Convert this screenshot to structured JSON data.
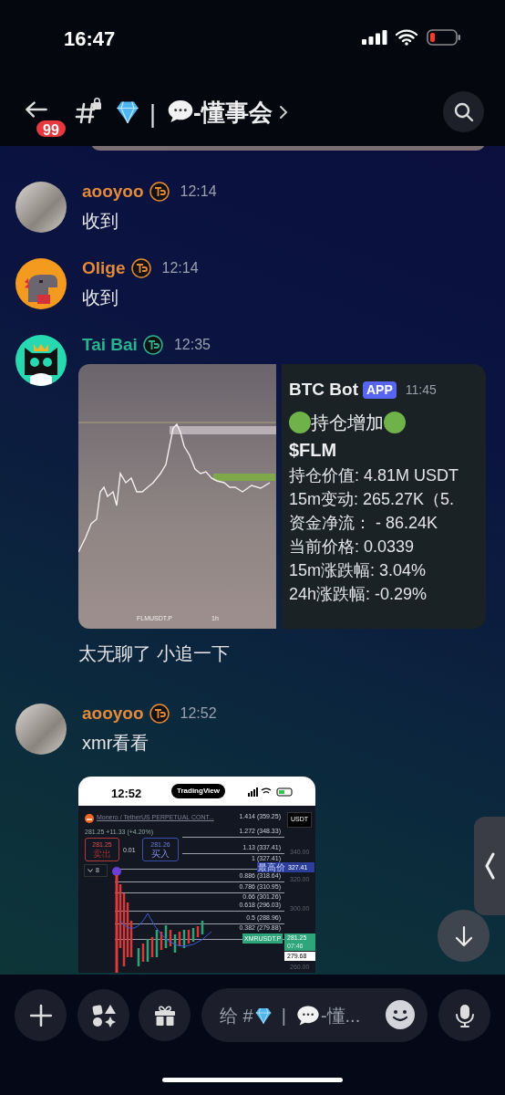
{
  "status_bar": {
    "time": "16:47"
  },
  "header": {
    "unread_badge": "99",
    "separator": "|",
    "channel_name": "-懂事会"
  },
  "messages": [
    {
      "author": "aooyoo",
      "color": "#e38a3b",
      "avatar": {
        "kind": "photo"
      },
      "time": "12:14",
      "text": "收到"
    },
    {
      "author": "Olige",
      "color": "#e38a3b",
      "avatar": {
        "kind": "dinosaur"
      },
      "time": "12:14",
      "text": "收到"
    },
    {
      "author": "Tai Bai",
      "color": "#2bb391",
      "avatar": {
        "kind": "cat"
      },
      "time": "12:35",
      "attachments": [
        {
          "kind": "chart_image",
          "caption": "FLMUSDT.P",
          "interval": "1h"
        },
        {
          "kind": "bot_embed",
          "bot": "BTC Bot",
          "tag": "APP",
          "time": "11:45",
          "headline": "持仓增加",
          "symbol": "$FLM",
          "lines": [
            "持仓价值: 4.81M USDT",
            "15m变动: 265.27K（5.",
            "资金净流： - 86.24K",
            "当前价格: 0.0339",
            "15m涨跌幅: 3.04%",
            "24h涨跌幅: -0.29%"
          ]
        }
      ],
      "text_after": "太无聊了 小追一下"
    },
    {
      "author": "aooyoo",
      "color": "#e38a3b",
      "avatar": {
        "kind": "photo"
      },
      "time": "12:52",
      "text": "xmr看看",
      "attachments": [
        {
          "kind": "phone_screenshot",
          "time": "12:52",
          "app_pill": "TradingView",
          "pair": "Monero / TetherUS PERPETUAL CONT...",
          "quote_currency": "USDT",
          "price_change": "281.25 +11.33 (+4.20%)",
          "sell_price": "281.25",
          "sell_label": "卖出",
          "spread": "0.01",
          "buy_price": "281.26",
          "buy_label": "买入",
          "indicator_count": "8",
          "fib_levels": [
            "1.414 (359.25)",
            "1.272 (348.33)",
            "1.13 (337.41)",
            "1 (327.41)",
            "0.886 (318.64)",
            "0.786 (310.95)",
            "0.66 (301.26)",
            "0.618 (296.03)",
            "0.5 (288.96)",
            "0.382 (279.88)"
          ],
          "axis_labels": [
            "340.00",
            "320.00",
            "300.00",
            "260.00"
          ],
          "high_label": "最高价",
          "high_price": "327.41",
          "symbol_label": "XMRUSDT.P",
          "last_price": "281.25",
          "countdown": "07:46",
          "low_price": "279.68"
        }
      ]
    }
  ],
  "composer": {
    "placeholder_prefix": "给 #",
    "placeholder_separator": "|",
    "placeholder_suffix": "-懂..."
  }
}
